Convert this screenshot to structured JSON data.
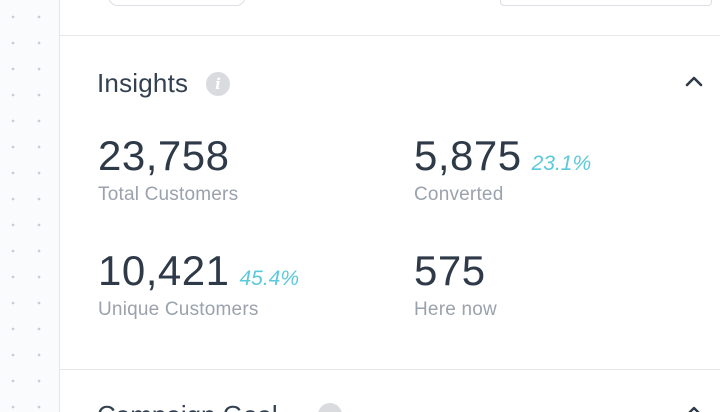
{
  "insights": {
    "title": "Insights",
    "info_icon": "info-icon",
    "collapse_icon": "chevron-up-icon",
    "stats": [
      {
        "value": "23,758",
        "percent": "",
        "label": "Total Customers"
      },
      {
        "value": "5,875",
        "percent": "23.1%",
        "label": "Converted"
      },
      {
        "value": "10,421",
        "percent": "45.4%",
        "label": "Unique Customers"
      },
      {
        "value": "575",
        "percent": "",
        "label": "Here now"
      }
    ]
  },
  "next_section": {
    "title": "Campaign Goal"
  },
  "colors": {
    "accent": "#5cc9da",
    "title": "#33404f",
    "value": "#2f3a49",
    "label": "#9aa2ad"
  }
}
